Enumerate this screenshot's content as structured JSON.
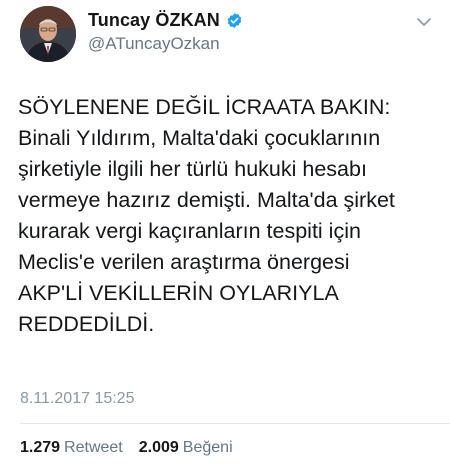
{
  "author": {
    "display_name": "Tuncay ÖZKAN",
    "handle": "@ATuncayOzkan",
    "verified": true,
    "verified_color": "#1da1f2"
  },
  "tweet": {
    "text": "SÖYLENENE DEĞİL İCRAATA BAKIN:\nBinali Yıldırım, Malta'daki çocuklarının\nşirketiyle ilgili her türlü hukuki hesabı\nvermeye hazırız demişti. Malta'da şirket\nkurarak vergi kaçıranların tespiti için\nMeclis'e verilen araştırma önergesi\nAKP'Lİ VEKİLLERİN OYLARIYLA\nREDDEDİLDİ.",
    "timestamp": "8.11.2017 15:25"
  },
  "stats": {
    "retweets_count": "1.279",
    "retweets_label": "Retweet",
    "likes_count": "2.009",
    "likes_label": "Beğeni"
  },
  "icons": {
    "menu": "chevron-down-icon",
    "verified": "verified-badge-icon"
  }
}
